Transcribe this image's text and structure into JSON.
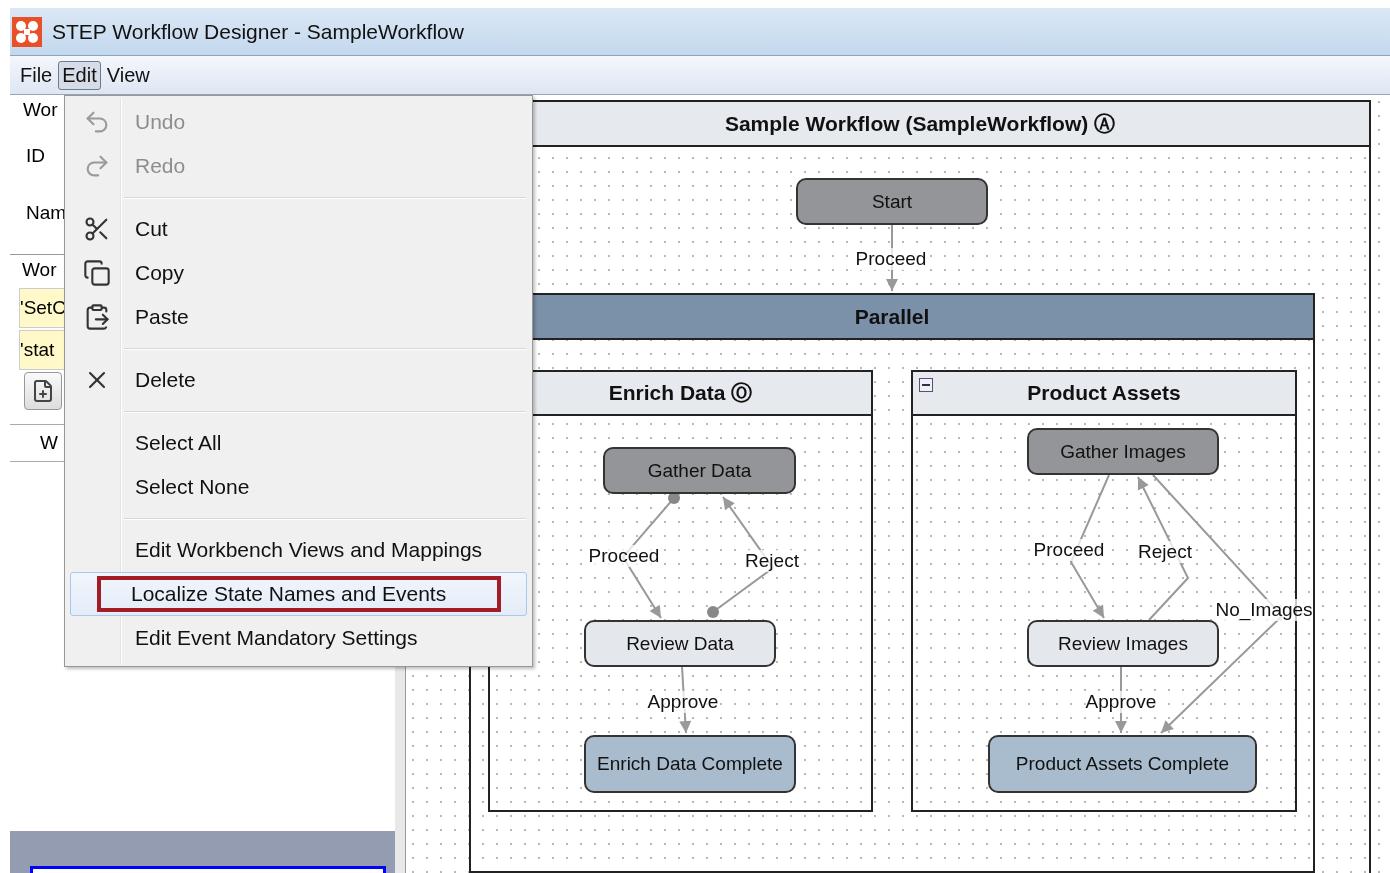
{
  "window": {
    "title": "STEP Workflow Designer - SampleWorkflow"
  },
  "menubar": [
    {
      "label": "File",
      "selected": false
    },
    {
      "label": "Edit",
      "selected": true
    },
    {
      "label": "View",
      "selected": false
    }
  ],
  "left_panel": {
    "fields": [
      "Wor",
      "ID",
      "Nam"
    ],
    "section": "Wor",
    "rows": [
      "'SetC",
      "'stat"
    ],
    "column_header": "W"
  },
  "edit_menu": [
    {
      "kind": "item",
      "label": "Undo",
      "disabled": true,
      "selected": false
    },
    {
      "kind": "item",
      "label": "Redo",
      "disabled": true,
      "selected": false
    },
    {
      "kind": "separator"
    },
    {
      "kind": "item",
      "label": "Cut",
      "disabled": false,
      "selected": false
    },
    {
      "kind": "item",
      "label": "Copy",
      "disabled": false,
      "selected": false
    },
    {
      "kind": "item",
      "label": "Paste",
      "disabled": false,
      "selected": false
    },
    {
      "kind": "separator"
    },
    {
      "kind": "item",
      "label": "Delete",
      "disabled": false,
      "selected": false
    },
    {
      "kind": "separator"
    },
    {
      "kind": "item",
      "label": "Select All",
      "disabled": false,
      "selected": false
    },
    {
      "kind": "item",
      "label": "Select None",
      "disabled": false,
      "selected": false
    },
    {
      "kind": "separator"
    },
    {
      "kind": "item",
      "label": "Edit Workbench Views and Mappings",
      "disabled": false,
      "selected": false
    },
    {
      "kind": "item",
      "label": "Localize State Names and Events",
      "disabled": false,
      "selected": true,
      "highlighted": true
    },
    {
      "kind": "item",
      "label": "Edit Event Mandatory Settings",
      "disabled": false,
      "selected": false
    }
  ],
  "diagram": {
    "workflow_title": "Sample Workflow (SampleWorkflow) Ⓐ",
    "parallel_title": "Parallel",
    "branches": [
      {
        "title": "Enrich Data Ⓞ",
        "collapse_button": false
      },
      {
        "title": "Product Assets",
        "collapse_button": true
      }
    ],
    "states": [
      {
        "label": "Start",
        "kind": "dark"
      },
      {
        "label": "Gather Data",
        "kind": "dark"
      },
      {
        "label": "Review Data",
        "kind": "light"
      },
      {
        "label": "Enrich Data Complete",
        "kind": "final"
      },
      {
        "label": "Gather Images",
        "kind": "dark"
      },
      {
        "label": "Review Images",
        "kind": "light"
      },
      {
        "label": "Product Assets Complete",
        "kind": "final"
      }
    ],
    "transitions": [
      {
        "label": "Proceed"
      },
      {
        "label": "Proceed"
      },
      {
        "label": "Reject"
      },
      {
        "label": "Approve"
      },
      {
        "label": "Proceed"
      },
      {
        "label": "Reject"
      },
      {
        "label": "No_Images"
      },
      {
        "label": "Approve"
      }
    ]
  }
}
